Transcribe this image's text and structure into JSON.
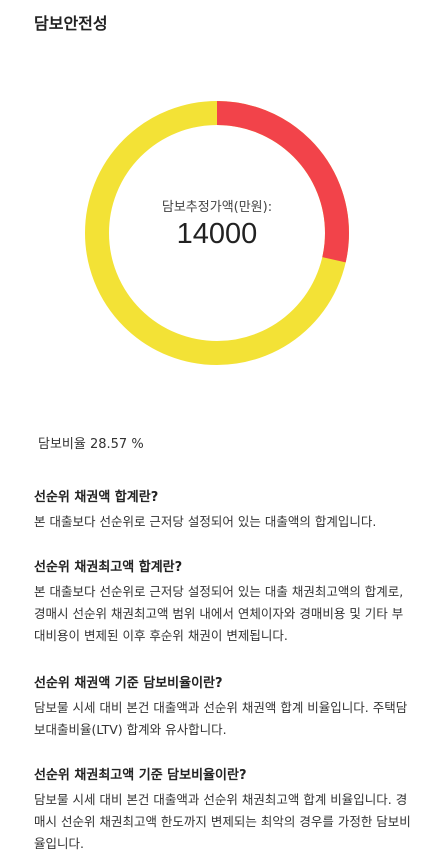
{
  "section_title": "담보안전성",
  "donut": {
    "center_label": "담보추정가액(만원):",
    "center_value": "14000",
    "ratio_percent": 28.57,
    "colors": {
      "ratio": "#f2434a",
      "remainder": "#f3e236"
    }
  },
  "ratio_text": "담보비율 28.57 %",
  "faq": [
    {
      "question": "선순위 채권액 합계란?",
      "answer": "본 대출보다 선순위로 근저당 설정되어 있는 대출액의 합계입니다."
    },
    {
      "question": "선순위 채권최고액 합계란?",
      "answer": "본 대출보다 선순위로 근저당 설정되어 있는 대출 채권최고액의 합계로, 경매시 선순위 채권최고액 범위 내에서 연체이자와 경매비용 및 기타 부대비용이 변제된 이후 후순위 채권이 변제됩니다."
    },
    {
      "question": "선순위 채권액 기준 담보비율이란?",
      "answer": "담보물 시세 대비 본건 대출액과 선순위 채권액 합계 비율입니다. 주택담보대출비율(LTV) 합계와 유사합니다."
    },
    {
      "question": "선순위 채권최고액 기준 담보비율이란?",
      "answer": "담보물 시세 대비 본건 대출액과 선순위 채권최고액 합계 비율입니다. 경매시 선순위 채권최고액 한도까지 변제되는 최악의 경우를 가정한 담보비율입니다."
    }
  ]
}
